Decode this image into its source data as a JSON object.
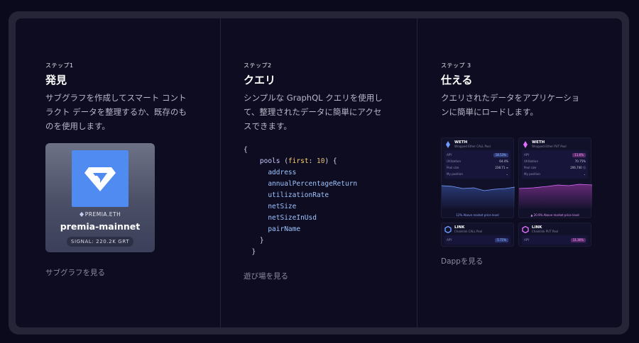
{
  "steps": [
    {
      "label": "ステップ1",
      "title": "発見",
      "desc_lines": [
        "サブグラフを作成してスマート コント",
        "ラクト データを整理するか、既存のも",
        "のを使用します。"
      ],
      "link": "サブグラフを見る"
    },
    {
      "label": "ステップ2",
      "title": "クエリ",
      "desc_lines": [
        "シンプルな GraphQL クエリを使用し",
        "て、整理されたデータに簡単にアクセ",
        "スできます。"
      ],
      "link": "遊び場を見る"
    },
    {
      "label": "ステップ 3",
      "title": "仕える",
      "desc_lines": [
        "クエリされたデータをアプリケーショ",
        "ンに簡単にロードします。"
      ],
      "link": "Dappを見る"
    }
  ],
  "subgraph": {
    "ens": "PREMIA.ETH",
    "name": "premia-mainnet",
    "signal": "SIGNAL: 220.2K GRT"
  },
  "query": {
    "open": "{",
    "entity": "pools",
    "arg_name": "first",
    "arg_value": "10",
    "fields": [
      "address",
      "annualPercentageReturn",
      "utilizationRate",
      "netSize",
      "netSizeInUsd",
      "pairName"
    ],
    "close_inner": "}",
    "close_outer": "}"
  },
  "dapp": {
    "cards": [
      {
        "token": "WETH",
        "subtitle": "Wrapped Ether CALL Pool",
        "accent": "#6f9bff",
        "apy_label": "APY",
        "apy": "18.53%",
        "rows": [
          [
            "Utilization",
            "64.4%"
          ],
          [
            "Pool size",
            "238.71 ≡"
          ],
          [
            "My position",
            "⌄"
          ]
        ],
        "footer": "12% Above market price level"
      },
      {
        "token": "WETH",
        "subtitle": "Wrapped Ether PUT Pool",
        "accent": "#e06cff",
        "apy_label": "APY",
        "apy": "11.6%",
        "rows": [
          [
            "Utilization",
            "70.75%"
          ],
          [
            "Pool size",
            "206,740 ⓢ"
          ],
          [
            "My position",
            "⌄"
          ]
        ],
        "footer": "▲ 20.9% Above market price level"
      },
      {
        "token": "LINK",
        "subtitle": "Chainlink CALL Pool",
        "accent": "#6f9bff",
        "apy_label": "APY",
        "apy": "5.71%"
      },
      {
        "token": "LINK",
        "subtitle": "Chainlink PUT Pool",
        "accent": "#e06cff",
        "apy_label": "APY",
        "apy": "11.36%"
      }
    ]
  }
}
